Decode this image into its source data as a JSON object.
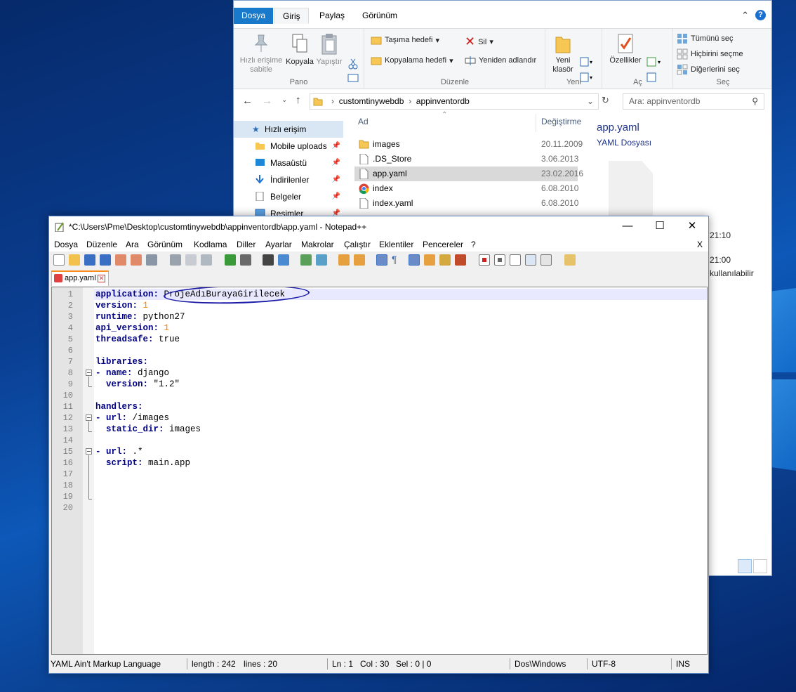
{
  "explorer": {
    "tabs": {
      "file": "Dosya",
      "home": "Giriş",
      "share": "Paylaş",
      "view": "Görünüm"
    },
    "ribbon": {
      "pin_label": "Hızlı erişime sabitle",
      "copy_label": "Kopyala",
      "paste_label": "Yapıştır",
      "group_clipboard": "Pano",
      "move_to": "Taşıma hedefi",
      "copy_to": "Kopyalama hedefi",
      "delete": "Sil",
      "rename": "Yeniden adlandır",
      "group_organize": "Düzenle",
      "new_folder": "Yeni klasör",
      "group_new": "Yeni",
      "properties": "Özellikler",
      "group_open": "Aç",
      "select_all": "Tümünü seç",
      "select_none": "Hiçbirini seçme",
      "invert_selection": "Diğerlerini seç",
      "group_select": "Seç"
    },
    "address": {
      "crumb1": "customtinywebdb",
      "crumb2": "appinventordb"
    },
    "search_placeholder": "Ara: appinventordb",
    "nav": {
      "quick_access": "Hızlı erişim",
      "items": [
        "Mobile uploads",
        "Masaüstü",
        "İndirilenler",
        "Belgeler",
        "Resimler"
      ]
    },
    "columns": {
      "name": "Ad",
      "date": "Değiştirme"
    },
    "files": [
      {
        "name": "images",
        "date": "20.11.2009",
        "icon": "folder-icon"
      },
      {
        "name": ".DS_Store",
        "date": "3.06.2013",
        "icon": "file-icon"
      },
      {
        "name": "app.yaml",
        "date": "23.02.2016",
        "icon": "file-icon"
      },
      {
        "name": "index",
        "date": "6.08.2010",
        "icon": "chrome-icon"
      },
      {
        "name": "index.yaml",
        "date": "6.08.2010",
        "icon": "file-icon"
      }
    ],
    "preview": {
      "title": "app.yaml",
      "subtitle": "YAML Dosyası"
    },
    "side_text": {
      "time1": "21:10",
      "time2": "21:00",
      "status": "kullanılabilir"
    }
  },
  "notepad": {
    "title": "*C:\\Users\\Pme\\Desktop\\customtinywebdb\\appinventordb\\app.yaml - Notepad++",
    "menu": [
      "Dosya",
      "Düzenle",
      "Ara",
      "Görünüm",
      "Kodlama",
      "Diller",
      "Ayarlar",
      "Makrolar",
      "Çalıştır",
      "Eklentiler",
      "Pencereler",
      "?"
    ],
    "menu_close": "X",
    "tab_name": "app.yaml",
    "lines": [
      {
        "n": "1",
        "key": "application:",
        "val": " ProjeAdıBurayaGirilecek",
        "num": false
      },
      {
        "n": "2",
        "key": "version:",
        "val": " 1",
        "num": true
      },
      {
        "n": "3",
        "key": "runtime:",
        "val": " python27",
        "num": false
      },
      {
        "n": "4",
        "key": "api_version:",
        "val": " 1",
        "num": true
      },
      {
        "n": "5",
        "key": "threadsafe:",
        "val": " true",
        "num": false
      },
      {
        "n": "6",
        "key": "",
        "val": "",
        "num": false
      },
      {
        "n": "7",
        "key": "libraries:",
        "val": "",
        "num": false
      },
      {
        "n": "8",
        "key": "- name:",
        "val": " django",
        "num": false
      },
      {
        "n": "9",
        "key": "  version:",
        "val": " \"1.2\"",
        "num": false
      },
      {
        "n": "10",
        "key": "",
        "val": "",
        "num": false
      },
      {
        "n": "11",
        "key": "handlers:",
        "val": "",
        "num": false
      },
      {
        "n": "12",
        "key": "- url:",
        "val": " /images",
        "num": false
      },
      {
        "n": "13",
        "key": "  static_dir:",
        "val": " images",
        "num": false
      },
      {
        "n": "14",
        "key": "",
        "val": "",
        "num": false
      },
      {
        "n": "15",
        "key": "- url:",
        "val": " .*",
        "num": false
      },
      {
        "n": "16",
        "key": "  script:",
        "val": " main.app",
        "num": false
      },
      {
        "n": "17",
        "key": "",
        "val": "",
        "num": false
      },
      {
        "n": "18",
        "key": "",
        "val": "",
        "num": false
      },
      {
        "n": "19",
        "key": "",
        "val": "",
        "num": false
      },
      {
        "n": "20",
        "key": "",
        "val": "",
        "num": false
      }
    ],
    "status": {
      "language": "YAML Ain't Markup Language",
      "length": "length : 242",
      "lines": "lines : 20",
      "ln": "Ln : 1",
      "col": "Col : 30",
      "sel": "Sel : 0 | 0",
      "eol": "Dos\\Windows",
      "encoding": "UTF-8",
      "mode": "INS"
    }
  }
}
